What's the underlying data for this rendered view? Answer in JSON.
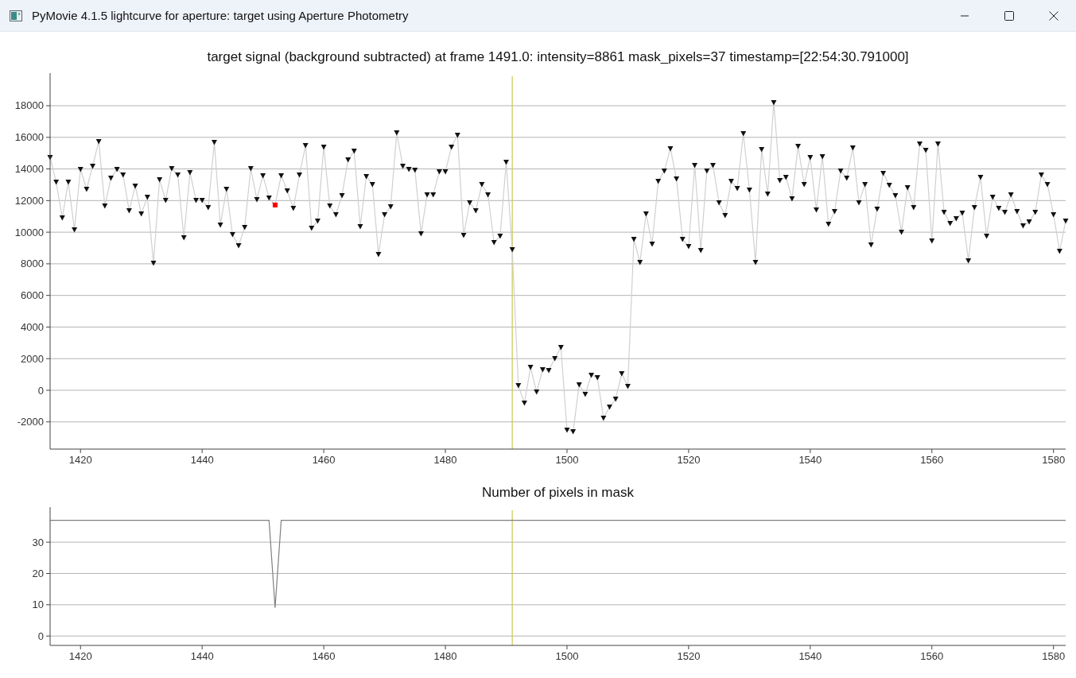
{
  "window": {
    "title": "PyMovie 4.1.5 lightcurve for aperture: target using Aperture Photometry"
  },
  "signal_plot": {
    "chart_data": {
      "type": "line",
      "title": "target signal (background subtracted) at frame 1491.0: intensity=8861 mask_pixels=37 timestamp=[22:54:30.791000]",
      "xlim": [
        1415,
        1582
      ],
      "ylim": [
        -3720,
        19860
      ],
      "xticks": [
        1420,
        1440,
        1460,
        1480,
        1500,
        1520,
        1540,
        1560,
        1580
      ],
      "yticks": [
        -2000,
        0,
        2000,
        4000,
        6000,
        8000,
        10000,
        12000,
        14000,
        16000,
        18000
      ],
      "x": [
        1415,
        1416,
        1417,
        1418,
        1419,
        1420,
        1421,
        1422,
        1423,
        1424,
        1425,
        1426,
        1427,
        1428,
        1429,
        1430,
        1431,
        1432,
        1433,
        1434,
        1435,
        1436,
        1437,
        1438,
        1439,
        1440,
        1441,
        1442,
        1443,
        1444,
        1445,
        1446,
        1447,
        1448,
        1449,
        1450,
        1451,
        1452,
        1453,
        1454,
        1455,
        1456,
        1457,
        1458,
        1459,
        1460,
        1461,
        1462,
        1463,
        1464,
        1465,
        1466,
        1467,
        1468,
        1469,
        1470,
        1471,
        1472,
        1473,
        1474,
        1475,
        1476,
        1477,
        1478,
        1479,
        1480,
        1481,
        1482,
        1483,
        1484,
        1485,
        1486,
        1487,
        1488,
        1489,
        1490,
        1491,
        1492,
        1493,
        1494,
        1495,
        1496,
        1497,
        1498,
        1499,
        1500,
        1501,
        1502,
        1503,
        1504,
        1505,
        1506,
        1507,
        1508,
        1509,
        1510,
        1511,
        1512,
        1513,
        1514,
        1515,
        1516,
        1517,
        1518,
        1519,
        1520,
        1521,
        1522,
        1523,
        1524,
        1525,
        1526,
        1527,
        1528,
        1529,
        1530,
        1531,
        1532,
        1533,
        1534,
        1535,
        1536,
        1537,
        1538,
        1539,
        1540,
        1541,
        1542,
        1543,
        1544,
        1545,
        1546,
        1547,
        1548,
        1549,
        1550,
        1551,
        1552,
        1553,
        1554,
        1555,
        1556,
        1557,
        1558,
        1559,
        1560,
        1561,
        1562,
        1563,
        1564,
        1565,
        1566,
        1567,
        1568,
        1569,
        1570,
        1571,
        1572,
        1573,
        1574,
        1575,
        1576,
        1577,
        1578,
        1579,
        1580,
        1581,
        1582
      ],
      "series": [
        {
          "color": "#d0d0d0",
          "marker": "triangle",
          "values": [
            14730,
            13170,
            10910,
            13170,
            10160,
            13980,
            12720,
            14180,
            15740,
            11660,
            13420,
            13980,
            13620,
            11360,
            12920,
            11160,
            12220,
            8040,
            13320,
            12020,
            14030,
            13620,
            9650,
            13780,
            12020,
            12020,
            11560,
            15690,
            10460,
            12720,
            9850,
            9150,
            10310,
            14030,
            12070,
            13580,
            12170,
            11720,
            13580,
            12620,
            11510,
            13620,
            15480,
            10260,
            10710,
            15390,
            11660,
            11110,
            12320,
            14580,
            15130,
            10360,
            13530,
            13020,
            8600,
            11110,
            11610,
            16290,
            14180,
            13980,
            13930,
            9900,
            12370,
            12370,
            13830,
            13830,
            15390,
            16140,
            9800,
            11870,
            11360,
            13020,
            12370,
            9350,
            9750,
            14430,
            8900,
            300,
            -800,
            1460,
            -100,
            1310,
            1260,
            2010,
            2720,
            -2510,
            -2610,
            350,
            -250,
            960,
            800,
            -1760,
            -1060,
            -550,
            1060,
            250,
            9550,
            8090,
            11160,
            9250,
            13220,
            13880,
            15290,
            13370,
            9550,
            9100,
            14230,
            8850,
            13880,
            14230,
            11870,
            11060,
            13220,
            12770,
            16240,
            12670,
            8090,
            15240,
            12420,
            18200,
            13270,
            13480,
            12120,
            15440,
            13020,
            14730,
            11410,
            14780,
            10510,
            11310,
            13880,
            13420,
            15340,
            11870,
            13020,
            9200,
            11460,
            13730,
            12970,
            12320,
            10010,
            12820,
            11560,
            15590,
            15180,
            9450,
            15590,
            11260,
            10560,
            10860,
            11210,
            8200,
            11560,
            13480,
            9750,
            12220,
            11510,
            11260,
            12370,
            11310,
            10410,
            10660,
            11260,
            13620,
            13020,
            11110,
            8800,
            10710
          ]
        },
        {
          "color": "#ff0000",
          "marker": "square",
          "values": [
            null,
            null,
            null,
            null,
            null,
            null,
            null,
            null,
            null,
            null,
            null,
            null,
            null,
            null,
            null,
            null,
            null,
            null,
            null,
            null,
            null,
            null,
            null,
            null,
            null,
            null,
            null,
            null,
            null,
            null,
            null,
            null,
            null,
            null,
            null,
            null,
            null,
            11720,
            null,
            null,
            null,
            null,
            null,
            null,
            null,
            null,
            null,
            null,
            null,
            null,
            null,
            null,
            null,
            null,
            null,
            null,
            null,
            null,
            null,
            null,
            null,
            null,
            null,
            null,
            null,
            null,
            null,
            null,
            null,
            null,
            null,
            null,
            null,
            null,
            null,
            null,
            null,
            null,
            null,
            null,
            null,
            null,
            null,
            null,
            null,
            null,
            null,
            null,
            null,
            null,
            null,
            null,
            null,
            null,
            null,
            null,
            null,
            null,
            null,
            null,
            null,
            null,
            null,
            null,
            null,
            null,
            null,
            null,
            null,
            null,
            null,
            null,
            null,
            null,
            null,
            null,
            null,
            null,
            null,
            null,
            null,
            null,
            null,
            null,
            null,
            null,
            null,
            null,
            null,
            null,
            null,
            null,
            null,
            null,
            null,
            null,
            null,
            null,
            null,
            null,
            null,
            null,
            null,
            null,
            null,
            null,
            null,
            null,
            null,
            null,
            null,
            null,
            null,
            null,
            null,
            null,
            null,
            null,
            null,
            null,
            null,
            null,
            null,
            null,
            null,
            null,
            null,
            null
          ]
        }
      ],
      "grid": true,
      "ref_lines": [
        {
          "axis": "x",
          "value": 1491
        }
      ]
    }
  },
  "mask_plot": {
    "chart_data": {
      "type": "line",
      "title": "Number of pixels in mask",
      "xlim": [
        1415,
        1582
      ],
      "ylim": [
        -3,
        40.2
      ],
      "xticks": [
        1420,
        1440,
        1460,
        1480,
        1500,
        1520,
        1540,
        1560,
        1580
      ],
      "yticks": [
        0,
        10,
        20,
        30
      ],
      "x": [
        1415,
        1416,
        1417,
        1418,
        1419,
        1420,
        1421,
        1422,
        1423,
        1424,
        1425,
        1426,
        1427,
        1428,
        1429,
        1430,
        1431,
        1432,
        1433,
        1434,
        1435,
        1436,
        1437,
        1438,
        1439,
        1440,
        1441,
        1442,
        1443,
        1444,
        1445,
        1446,
        1447,
        1448,
        1449,
        1450,
        1451,
        1452,
        1453,
        1454,
        1455,
        1456,
        1457,
        1458,
        1459,
        1460,
        1461,
        1462,
        1463,
        1464,
        1465,
        1466,
        1467,
        1468,
        1469,
        1470,
        1471,
        1472,
        1473,
        1474,
        1475,
        1476,
        1477,
        1478,
        1479,
        1480,
        1481,
        1482,
        1483,
        1484,
        1485,
        1486,
        1487,
        1488,
        1489,
        1490,
        1491,
        1492,
        1493,
        1494,
        1495,
        1496,
        1497,
        1498,
        1499,
        1500,
        1501,
        1502,
        1503,
        1504,
        1505,
        1506,
        1507,
        1508,
        1509,
        1510,
        1511,
        1512,
        1513,
        1514,
        1515,
        1516,
        1517,
        1518,
        1519,
        1520,
        1521,
        1522,
        1523,
        1524,
        1525,
        1526,
        1527,
        1528,
        1529,
        1530,
        1531,
        1532,
        1533,
        1534,
        1535,
        1536,
        1537,
        1538,
        1539,
        1540,
        1541,
        1542,
        1543,
        1544,
        1545,
        1546,
        1547,
        1548,
        1549,
        1550,
        1551,
        1552,
        1553,
        1554,
        1555,
        1556,
        1557,
        1558,
        1559,
        1560,
        1561,
        1562,
        1563,
        1564,
        1565,
        1566,
        1567,
        1568,
        1569,
        1570,
        1571,
        1572,
        1573,
        1574,
        1575,
        1576,
        1577,
        1578,
        1579,
        1580,
        1581,
        1582
      ],
      "series": [
        {
          "color": "#808080",
          "values": [
            37,
            37,
            37,
            37,
            37,
            37,
            37,
            37,
            37,
            37,
            37,
            37,
            37,
            37,
            37,
            37,
            37,
            37,
            37,
            37,
            37,
            37,
            37,
            37,
            37,
            37,
            37,
            37,
            37,
            37,
            37,
            37,
            37,
            37,
            37,
            37,
            37,
            9,
            37,
            37,
            37,
            37,
            37,
            37,
            37,
            37,
            37,
            37,
            37,
            37,
            37,
            37,
            37,
            37,
            37,
            37,
            37,
            37,
            37,
            37,
            37,
            37,
            37,
            37,
            37,
            37,
            37,
            37,
            37,
            37,
            37,
            37,
            37,
            37,
            37,
            37,
            37,
            37,
            37,
            37,
            37,
            37,
            37,
            37,
            37,
            37,
            37,
            37,
            37,
            37,
            37,
            37,
            37,
            37,
            37,
            37,
            37,
            37,
            37,
            37,
            37,
            37,
            37,
            37,
            37,
            37,
            37,
            37,
            37,
            37,
            37,
            37,
            37,
            37,
            37,
            37,
            37,
            37,
            37,
            37,
            37,
            37,
            37,
            37,
            37,
            37,
            37,
            37,
            37,
            37,
            37,
            37,
            37,
            37,
            37,
            37,
            37,
            37,
            37,
            37,
            37,
            37,
            37,
            37,
            37,
            37,
            37,
            37,
            37,
            37,
            37,
            37,
            37,
            37,
            37,
            37,
            37,
            37,
            37,
            37,
            37,
            37,
            37,
            37,
            37,
            37,
            37,
            37
          ]
        }
      ],
      "grid": true,
      "ref_lines": [
        {
          "axis": "x",
          "value": 1491
        }
      ]
    }
  }
}
